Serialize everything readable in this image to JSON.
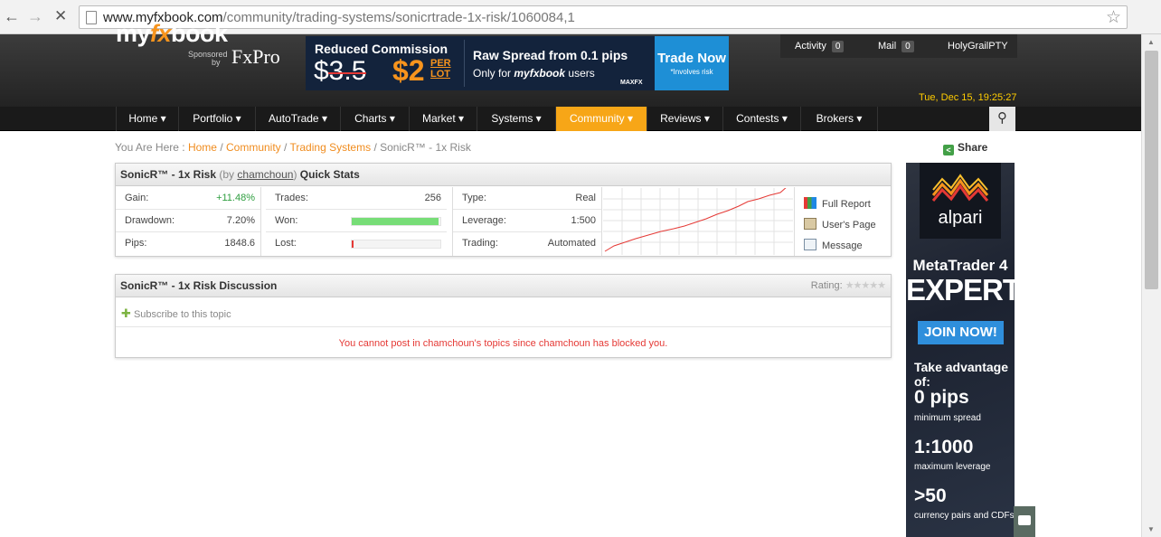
{
  "browser": {
    "url_host": "www.myfxbook.com",
    "url_path": "/community/trading-systems/sonicrtrade-1x-risk/1060084,1"
  },
  "header": {
    "logo_pre": "my",
    "logo_fx": "fx",
    "logo_post": "book",
    "sponsored_line1": "Sponsored",
    "sponsored_line2": "by",
    "sponsor": "FxPro",
    "date": "Tue, Dec 15, 19:25:27",
    "ad": {
      "reduced": "Reduced Commission",
      "old_price": "$3.5",
      "new_price": "$2",
      "per_lot_1": "PER",
      "per_lot_2": "LOT",
      "raw_spread": "Raw Spread from 0.1 pips",
      "only_pre": "Only for",
      "only_brand": "myfxbook",
      "only_post": "users",
      "broker": "MAXFX",
      "cta": "Trade Now",
      "cta_note": "*Involves risk"
    },
    "user": {
      "activity_label": "Activity",
      "activity_count": "0",
      "mail_label": "Mail",
      "mail_count": "0",
      "username": "HolyGrailPTY"
    }
  },
  "menu": [
    "Home ▾",
    "Portfolio ▾",
    "AutoTrade ▾",
    "Charts ▾",
    "Market ▾",
    "Systems ▾",
    "Community ▾",
    "Reviews ▾",
    "Contests ▾",
    "Brokers ▾"
  ],
  "breadcrumb": {
    "prefix": "You Are Here :",
    "home": "Home",
    "community": "Community",
    "trading_systems": "Trading Systems",
    "sep": "/",
    "current": "SonicR™ - 1x Risk"
  },
  "share": "Share",
  "quick_stats": {
    "title": "SonicR™ - 1x Risk",
    "by_pre": "(by",
    "by_user": "chamchoun",
    "by_post": ")",
    "suffix": "Quick Stats",
    "gain_label": "Gain:",
    "gain_value": "+11.48%",
    "drawdown_label": "Drawdown:",
    "drawdown_value": "7.20%",
    "pips_label": "Pips:",
    "pips_value": "1848.6",
    "trades_label": "Trades:",
    "trades_value": "256",
    "won_label": "Won:",
    "won_fraction": 0.98,
    "lost_label": "Lost:",
    "lost_fraction": 0.02,
    "type_label": "Type:",
    "type_value": "Real",
    "leverage_label": "Leverage:",
    "leverage_value": "1:500",
    "trading_label": "Trading:",
    "trading_value": "Automated",
    "links": [
      "Full Report",
      "User's Page",
      "Message"
    ]
  },
  "discussion": {
    "title": "SonicR™ - 1x Risk Discussion",
    "rating_label": "Rating:",
    "subscribe": "Subscribe to this topic",
    "blocked_msg": "You cannot post in chamchoun's topics since chamchoun has blocked you."
  },
  "banner": {
    "brand": "alpari",
    "line1": "MetaTrader 4",
    "line2": "EXPERT",
    "cta": "JOIN NOW!",
    "take": "Take advantage of:",
    "f1_big": "0 pips",
    "f1_small": "minimum spread",
    "f2_big": "1:1000",
    "f2_small": "maximum leverage",
    "f3_big": ">50",
    "f3_small": "currency pairs and CDFs"
  }
}
